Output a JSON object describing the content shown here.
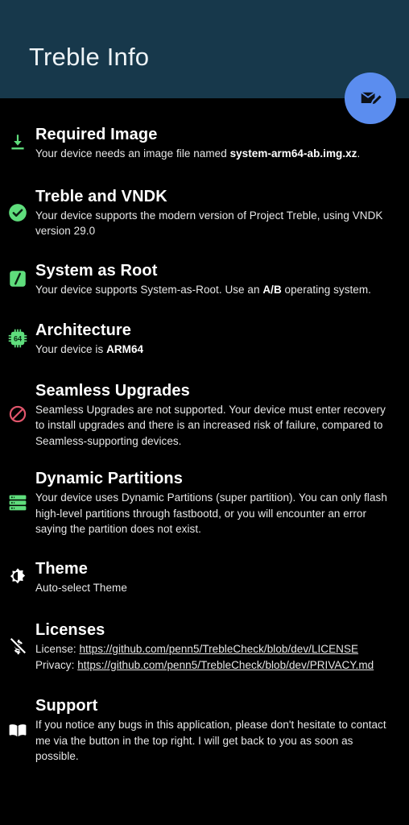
{
  "app": {
    "title": "Treble Info",
    "header_bg": "#17384b",
    "page_bg": "#000000",
    "accent_green": "#5fdd7c",
    "accent_red": "#e0556b",
    "fab_blue": "#5b8def"
  },
  "fab": {
    "name": "contact-developer-button",
    "icon": "email-edit-icon",
    "label": "Contact developer"
  },
  "items": [
    {
      "id": "required-image",
      "icon": "download-icon",
      "icon_color": "#5fdd7c",
      "title": "Required Image",
      "desc_parts": [
        {
          "t": "Your device needs an image file named ",
          "bold": false
        },
        {
          "t": "system-arm64-ab.img.xz",
          "bold": true
        },
        {
          "t": ".",
          "bold": false
        }
      ]
    },
    {
      "id": "treble-and-vndk",
      "icon": "check-circle-icon",
      "icon_color": "#5fdd7c",
      "title": "Treble and VNDK",
      "desc_parts": [
        {
          "t": "Your device supports the modern version of Project Treble, using VNDK version 29.0",
          "bold": false
        }
      ]
    },
    {
      "id": "system-as-root",
      "icon": "slash-square-icon",
      "icon_color": "#5fdd7c",
      "title": "System as Root",
      "desc_parts": [
        {
          "t": "Your device supports System-as-Root. Use an ",
          "bold": false
        },
        {
          "t": "A/B",
          "bold": true
        },
        {
          "t": " operating system.",
          "bold": false
        }
      ]
    },
    {
      "id": "architecture",
      "icon": "cpu-chip-64-icon",
      "icon_color": "#5fdd7c",
      "title": "Architecture",
      "desc_parts": [
        {
          "t": "Your device is ",
          "bold": false
        },
        {
          "t": "ARM64",
          "bold": true
        }
      ]
    },
    {
      "id": "seamless-upgrades",
      "icon": "block-circle-slash-icon",
      "icon_color": "#e0556b",
      "title": "Seamless Upgrades",
      "desc_parts": [
        {
          "t": "Seamless Upgrades are not supported. Your device must enter recovery to install upgrades and there is an increased risk of failure, compared to Seamless-supporting devices.",
          "bold": false
        }
      ]
    },
    {
      "id": "dynamic-partitions",
      "icon": "storage-stack-icon",
      "icon_color": "#5fdd7c",
      "title": "Dynamic Partitions",
      "desc_parts": [
        {
          "t": "Your device uses Dynamic Partitions (super partition). You can only flash high-level partitions through fastbootd, or you will encounter an error saying the partition does not exist.",
          "bold": false
        }
      ]
    },
    {
      "id": "theme",
      "icon": "brightness-auto-icon",
      "icon_color": "#ffffff",
      "title": "Theme",
      "desc_parts": [
        {
          "t": "Auto-select Theme",
          "bold": false
        }
      ]
    },
    {
      "id": "licenses",
      "icon": "money-off-icon",
      "icon_color": "#ffffff",
      "title": "Licenses",
      "lines": [
        {
          "prefix": "License: ",
          "link": "https://github.com/penn5/TrebleCheck/blob/dev/LICENSE"
        },
        {
          "prefix": "Privacy: ",
          "link": "https://github.com/penn5/TrebleCheck/blob/dev/PRIVACY.md"
        }
      ]
    },
    {
      "id": "support",
      "icon": "open-book-icon",
      "icon_color": "#ffffff",
      "title": "Support",
      "desc_parts": [
        {
          "t": "If you notice any bugs in this application, please don't hesitate to contact me via the button in the top right. I will get back to you as soon as possible.",
          "bold": false
        }
      ]
    }
  ]
}
